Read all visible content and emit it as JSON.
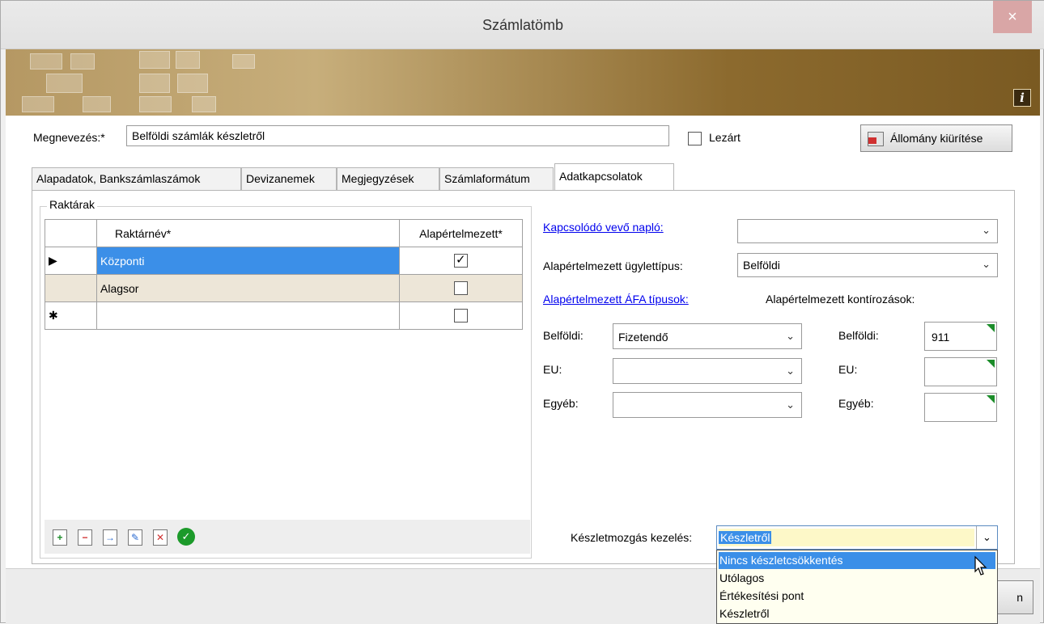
{
  "window": {
    "title": "Számlatömb",
    "close_glyph": "×",
    "info_glyph": "i"
  },
  "form": {
    "megnevezes_label": "Megnevezés:*",
    "megnevezes_value": "Belföldi számlák készletről",
    "lezart_label": "Lezárt",
    "allomany_button": "Állomány kiürítése"
  },
  "tabs": [
    {
      "label": "Alapadatok, Bankszámlaszámok"
    },
    {
      "label": "Devizanemek"
    },
    {
      "label": "Megjegyzések"
    },
    {
      "label": "Számlaformátum"
    },
    {
      "label": "Adatkapcsolatok",
      "active": true
    }
  ],
  "raktarak": {
    "group_title": "Raktárak",
    "col_name": "Raktárnév*",
    "col_default": "Alapértelmezett*",
    "rows": [
      {
        "indicator": "▶",
        "name": "Központi",
        "default": true
      },
      {
        "indicator": "",
        "name": "Alagsor",
        "default": false
      },
      {
        "indicator": "✱",
        "name": "",
        "default": false
      }
    ],
    "toolbar_icons": [
      "add-icon",
      "remove-icon",
      "move-icon",
      "edit-icon",
      "delete-icon",
      "confirm-icon"
    ]
  },
  "right": {
    "kapcsolodo_link": "Kapcsolódó vevő napló:",
    "kapcsolodo_value": "",
    "ugylettipus_label": "Alapértelmezett ügylettípus:",
    "ugylettipus_value": "Belföldi",
    "afa_link": "Alapértelmezett ÁFA típusok:",
    "kontir_label": "Alapértelmezett kontírozások:",
    "afa_rows": [
      {
        "label": "Belföldi:",
        "value": "Fizetendő",
        "kontir_label": "Belföldi:",
        "kontir_value": "911"
      },
      {
        "label": "EU:",
        "value": "",
        "kontir_label": "EU:",
        "kontir_value": ""
      },
      {
        "label": "Egyéb:",
        "value": "",
        "kontir_label": "Egyéb:",
        "kontir_value": ""
      }
    ],
    "keszlet_label": "Készletmozgás kezelés:",
    "keszlet_value": "Készletről",
    "keszlet_options": [
      "Nincs készletcsökkentés",
      "Utólagos",
      "Értékesítési pont",
      "Készletről"
    ],
    "keszlet_highlighted": 0
  },
  "bottom": {
    "button_fragment": "n"
  },
  "colors": {
    "accent": "#3b8fe8",
    "link": "#0000ee",
    "kontir_marker": "#1c8d2a"
  }
}
